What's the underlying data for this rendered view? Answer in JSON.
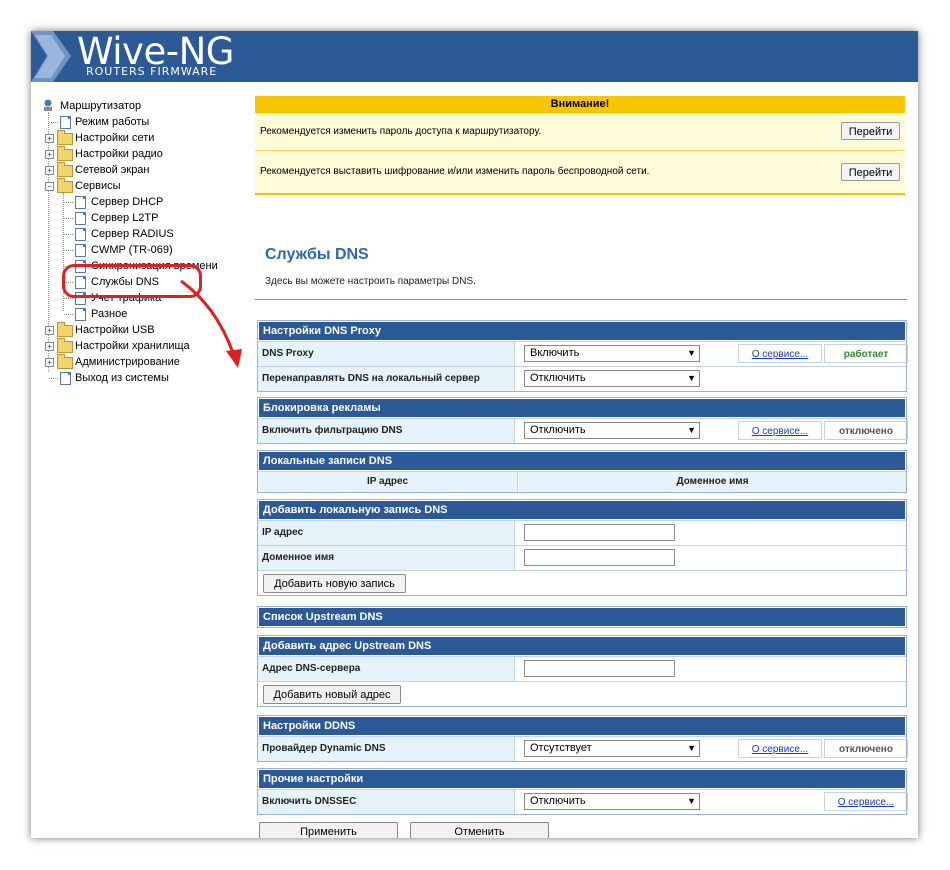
{
  "header": {
    "brand": "Wive-NG",
    "subtitle": "ROUTERS FIRMWARE",
    "bg_color": "#2c5a97"
  },
  "tree": {
    "root": "Маршрутизатор",
    "items": [
      {
        "label": "Режим работы",
        "icon": "page-icon"
      },
      {
        "label": "Настройки сети",
        "icon": "folder-icon"
      },
      {
        "label": "Настройки радио",
        "icon": "folder-icon"
      },
      {
        "label": "Сетевой экран",
        "icon": "folder-icon"
      },
      {
        "label": "Сервисы",
        "icon": "folder-icon"
      },
      {
        "label": "Сервер DHCP",
        "icon": "page-icon"
      },
      {
        "label": "Сервер L2TP",
        "icon": "page-icon"
      },
      {
        "label": "Сервер RADIUS",
        "icon": "page-icon"
      },
      {
        "label": "CWMP (TR-069)",
        "icon": "page-icon"
      },
      {
        "label": "Синхронизация времени",
        "icon": "page-icon"
      },
      {
        "label": "Службы DNS",
        "icon": "page-icon"
      },
      {
        "label": "Учет трафика",
        "icon": "page-icon"
      },
      {
        "label": "Разное",
        "icon": "page-icon"
      },
      {
        "label": "Настройки USB",
        "icon": "folder-icon"
      },
      {
        "label": "Настройки хранилища",
        "icon": "folder-icon"
      },
      {
        "label": "Администрирование",
        "icon": "folder-icon"
      },
      {
        "label": "Выход из системы",
        "icon": "page-icon"
      }
    ]
  },
  "warning": {
    "title": "Внимание!",
    "rows": [
      {
        "text": "Рекомендуется изменить пароль доступа к маршрутизатору.",
        "button": "Перейти"
      },
      {
        "text": "Рекомендуется выставить шифрование и/или изменить пароль беспроводной сети.",
        "button": "Перейти"
      }
    ]
  },
  "page": {
    "title": "Службы DNS",
    "description": "Здесь вы можете настроить параметры DNS."
  },
  "sections": {
    "proxy": {
      "title": "Настройки DNS Proxy",
      "row1_label": "DNS Proxy",
      "row1_value": "Включить",
      "row1_link": "О сервисе...",
      "row1_status": "работает",
      "row2_label": "Перенаправлять DNS на локальный сервер",
      "row2_value": "Отключить"
    },
    "adblock": {
      "title": "Блокировка рекламы",
      "label": "Включить фильтрацию DNS",
      "value": "Отключить",
      "link": "О сервисе...",
      "status": "отключено"
    },
    "local": {
      "title": "Локальные записи DNS",
      "col_ip": "IP адрес",
      "col_domain": "Доменное имя"
    },
    "add_local": {
      "title": "Добавить локальную запись DNS",
      "ip_label": "IP адрес",
      "domain_label": "Доменное имя",
      "button": "Добавить новую запись"
    },
    "upstream_list": {
      "title": "Список Upstream DNS"
    },
    "add_upstream": {
      "title": "Добавить адрес Upstream DNS",
      "label": "Адрес DNS-сервера",
      "button": "Добавить новый адрес"
    },
    "ddns": {
      "title": "Настройки DDNS",
      "label": "Провайдер Dynamic DNS",
      "value": "Отсутствует",
      "link": "О сервисе...",
      "status": "отключено"
    },
    "other": {
      "title": "Прочие настройки",
      "label": "Включить DNSSEC",
      "value": "Отключить",
      "link": "О сервисе..."
    }
  },
  "footer": {
    "apply": "Применить",
    "cancel": "Отменить"
  },
  "colors": {
    "status_running": "#2e8b2e",
    "status_off": "#555555",
    "highlight": "#e02020",
    "warning_bar": "#f7c600"
  }
}
